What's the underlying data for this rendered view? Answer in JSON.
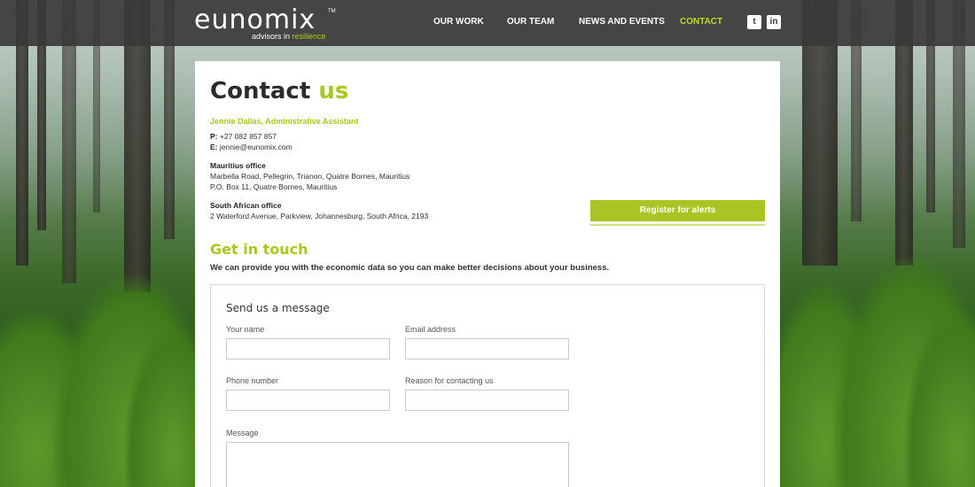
{
  "brand": {
    "logo_word": "eunomix",
    "logo_tm": "TM",
    "tagline_prefix": "advisors in",
    "tagline_accent": "resilience",
    "accent_color": "#a7c81d"
  },
  "nav": {
    "items": [
      {
        "label": "OUR WORK"
      },
      {
        "label": "OUR TEAM"
      },
      {
        "label": "NEWS AND EVENTS"
      },
      {
        "label": "CONTACT",
        "active": true
      }
    ],
    "social": [
      {
        "icon": "twitter-icon",
        "glyph": "t"
      },
      {
        "icon": "linkedin-icon",
        "glyph": "in"
      }
    ]
  },
  "page": {
    "title_main": "Contact",
    "title_accent": "us",
    "contact_name": "Jennie Dallas, Administrative Assistant",
    "phone_label": "P:",
    "phone_value": "+27 082 857 857",
    "email_label": "E:",
    "email_value": "jennie@eunomix.com",
    "offices": [
      {
        "name": "Mauritius office",
        "lines": [
          "Marbella Road, Pellegrin, Trianon, Quatre Bornes, Mauritius",
          "P.O. Box 11, Quatre Bornes, Mauritius"
        ]
      },
      {
        "name": "South African office",
        "lines": [
          "2 Waterford Avenue, Parkview, Johannesburg, South Africa, 2193"
        ]
      }
    ],
    "register_button": "Register for alerts",
    "section_title": "Get in touch",
    "intro": "We can provide you with the economic data so you can make better decisions about your business."
  },
  "form": {
    "title": "Send us a message",
    "name_label": "Your name",
    "email_label": "Email address",
    "phone_label": "Phone number",
    "reason_label": "Reason for contacting us",
    "message_label": "Message",
    "name_value": "",
    "email_value": "",
    "phone_value": "",
    "reason_value": "",
    "message_value": ""
  }
}
